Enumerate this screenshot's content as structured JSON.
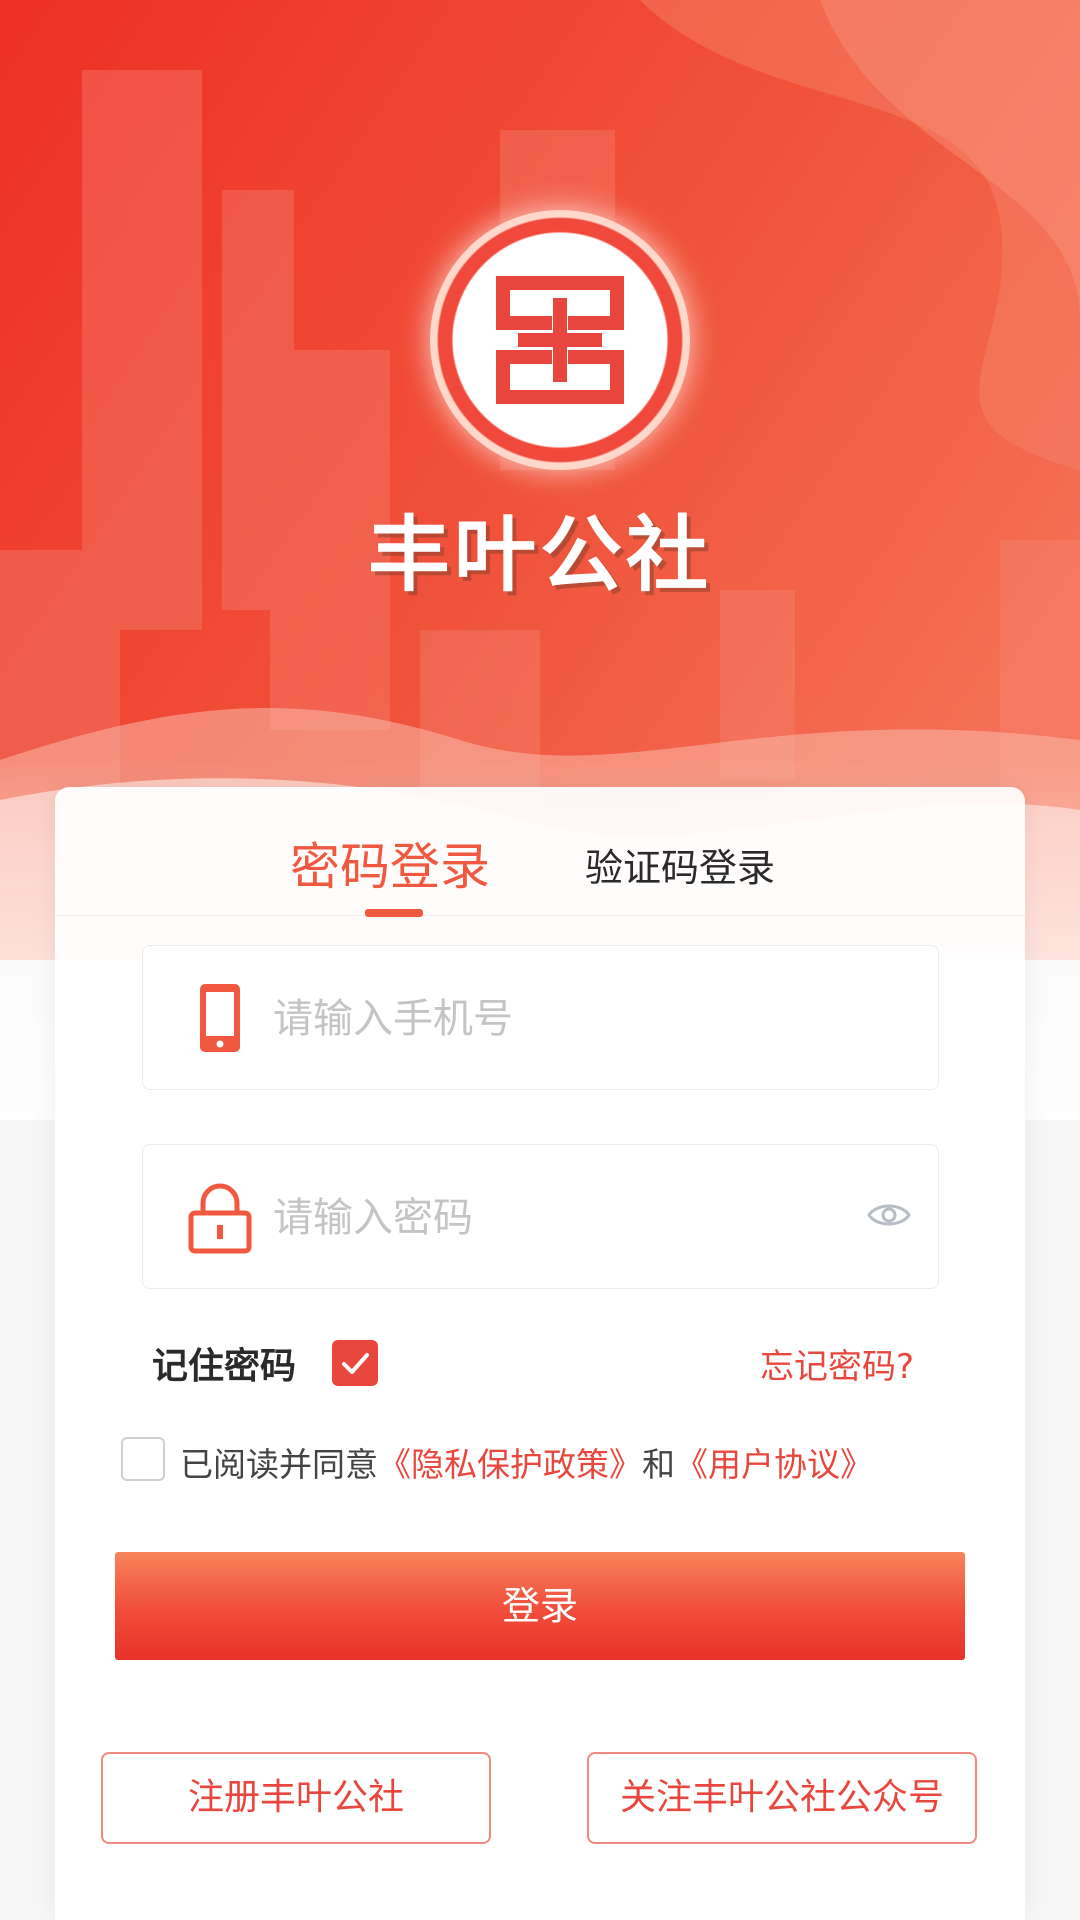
{
  "app": {
    "name": "丰叶公社",
    "accent_color": "#e9473d",
    "logo_icon": "bank-logo-icon"
  },
  "tabs": [
    {
      "label": "密码登录",
      "active": true
    },
    {
      "label": "验证码登录",
      "active": false
    }
  ],
  "form": {
    "phone": {
      "placeholder": "请输入手机号",
      "value": "",
      "icon": "mobile-phone-icon"
    },
    "password": {
      "placeholder": "请输入密码",
      "value": "",
      "icon": "lock-icon",
      "toggle_icon": "eye-icon"
    },
    "remember": {
      "label": "记住密码",
      "checked": true
    },
    "forgot_label": "忘记密码?",
    "agreement": {
      "checked": false,
      "prefix": "已阅读并同意",
      "privacy_link": "《隐私保护政策》",
      "conjunction": "和",
      "terms_link": "《用户协议》"
    },
    "login_label": "登录"
  },
  "footer_buttons": {
    "register_label": "注册丰叶公社",
    "follow_label": "关注丰叶公社公众号"
  }
}
